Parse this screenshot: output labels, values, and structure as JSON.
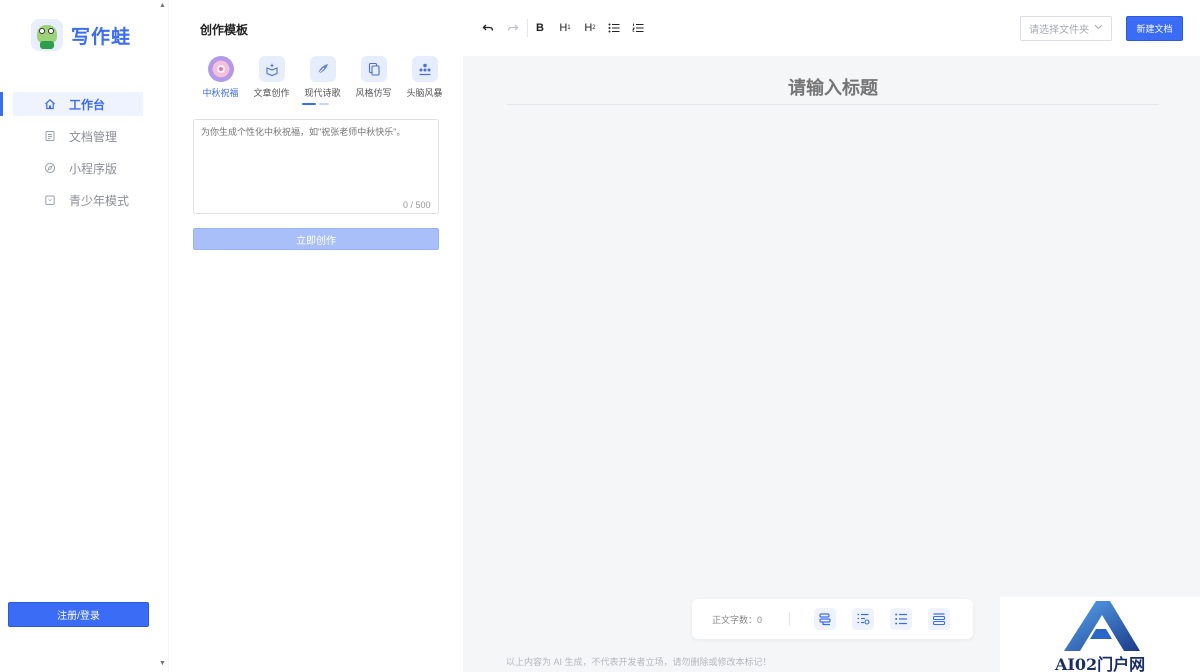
{
  "app": {
    "logo_text": "写作蛙"
  },
  "sidebar": {
    "items": [
      {
        "label": "工作台",
        "icon": "home-icon",
        "active": true
      },
      {
        "label": "文档管理",
        "icon": "document-icon",
        "active": false
      },
      {
        "label": "小程序版",
        "icon": "compass-icon",
        "active": false
      },
      {
        "label": "青少年模式",
        "icon": "shield-icon",
        "active": false
      }
    ],
    "login_label": "注册/登录"
  },
  "templates": {
    "title": "创作模板",
    "tabs": [
      {
        "label": "中秋祝福",
        "icon": "mooncake-icon",
        "active": true
      },
      {
        "label": "文章创作",
        "icon": "box-sparkle-icon",
        "active": false
      },
      {
        "label": "现代诗歌",
        "icon": "feather-icon",
        "active": false
      },
      {
        "label": "风格仿写",
        "icon": "copy-icon",
        "active": false
      },
      {
        "label": "头脑风暴",
        "icon": "people-icon",
        "active": false
      }
    ],
    "prompt_placeholder": "为你生成个性化中秋祝福，如\"祝张老师中秋快乐\"。",
    "counter": "0 / 500",
    "create_label": "立即创作"
  },
  "toolbar": {
    "undo": "undo-icon",
    "redo": "redo-icon",
    "bold": "B",
    "h1": "H",
    "h1_sub": "1",
    "h2": "H",
    "h2_sub": "2",
    "bullet": "bullet-list-icon",
    "ordered": "ordered-list-icon",
    "folder_placeholder": "请选择文件夹",
    "new_doc_label": "新建文档"
  },
  "editor": {
    "title_placeholder": "请输入标题",
    "word_count_label": "正文字数：",
    "word_count": "0",
    "disclaimer": "以上内容为 AI 生成，不代表开发者立场，请勿删除或修改本标记！"
  },
  "watermark": {
    "text": "AI02门户网"
  },
  "colors": {
    "accent": "#3b6cf6",
    "accent_light": "#a8bffa",
    "editor_bg": "#f5f6f8"
  }
}
